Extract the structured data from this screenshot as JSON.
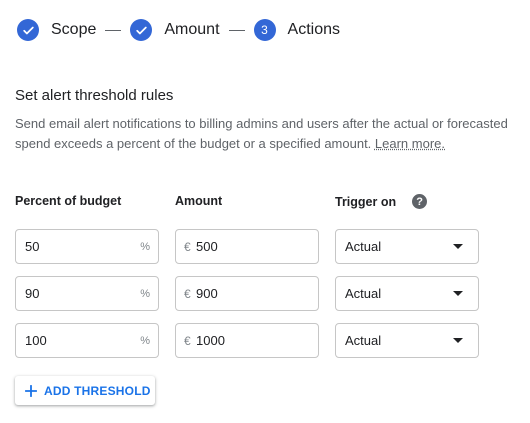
{
  "colors": {
    "accent": "#1a73e8",
    "step_circle": "#3367d6",
    "text_primary": "#202124",
    "text_secondary": "#5f6368",
    "border": "#c6c6c6"
  },
  "stepper": {
    "steps": [
      {
        "label": "Scope",
        "state": "complete",
        "icon": "check-icon"
      },
      {
        "label": "Amount",
        "state": "complete",
        "icon": "check-icon"
      },
      {
        "label": "Actions",
        "state": "active",
        "number": "3"
      }
    ]
  },
  "section": {
    "title": "Set alert threshold rules",
    "description_line1": "Send email alert notifications to billing admins and users after the actual or forecasted",
    "description_line2_prefix": "spend exceeds a percent of the budget or a specified amount. ",
    "learn_more": "Learn more."
  },
  "columns": {
    "percent": "Percent of budget",
    "amount": "Amount",
    "trigger": "Trigger on",
    "help_icon": "?"
  },
  "thresholds": [
    {
      "percent": "50",
      "percent_suffix": "%",
      "currency": "€",
      "amount": "500",
      "trigger": "Actual"
    },
    {
      "percent": "90",
      "percent_suffix": "%",
      "currency": "€",
      "amount": "900",
      "trigger": "Actual"
    },
    {
      "percent": "100",
      "percent_suffix": "%",
      "currency": "€",
      "amount": "1000",
      "trigger": "Actual"
    }
  ],
  "add_button": {
    "label": "ADD THRESHOLD",
    "icon": "plus-icon"
  }
}
